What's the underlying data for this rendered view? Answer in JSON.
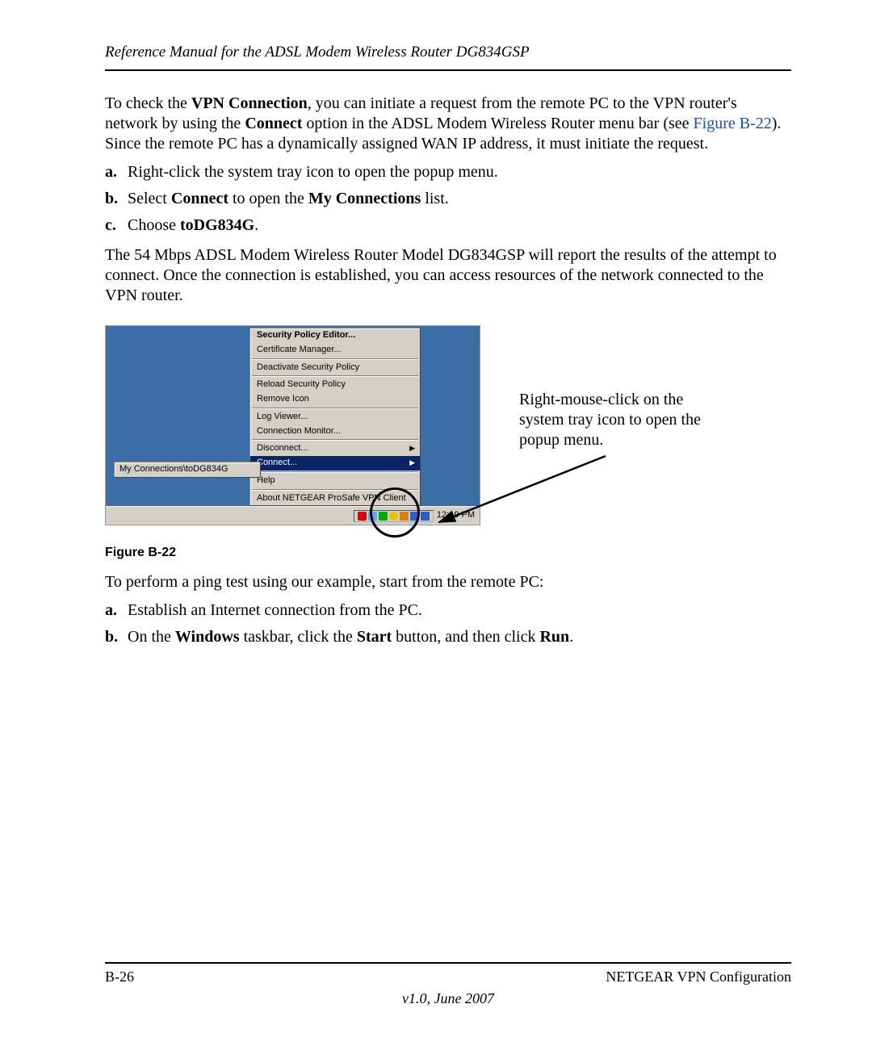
{
  "header": {
    "title": "Reference Manual for the ADSL Modem Wireless Router DG834GSP"
  },
  "intro": {
    "p1a": "To check the ",
    "vpn": "VPN Connection",
    "p1b": ", you can initiate a request from the remote PC to the VPN router's network by using the ",
    "connect": "Connect",
    "p1c": " option in the ADSL Modem Wireless Router menu bar (see ",
    "figlink": "Figure B-22",
    "p1d": "). Since the remote PC has a dynamically assigned WAN IP address, it must initiate the request."
  },
  "steps1": {
    "a": {
      "m": "a.",
      "t": "Right-click the system tray icon to open the popup menu."
    },
    "b": {
      "m": "b.",
      "pre": "Select ",
      "b1": "Connect",
      "mid": " to open the ",
      "b2": "My Connections",
      "post": " list."
    },
    "c": {
      "m": "c.",
      "pre": "Choose ",
      "b1": "toDG834G",
      "post": "."
    }
  },
  "result": "The 54 Mbps ADSL Modem Wireless Router Model DG834GSP will report the results of the attempt to connect. Once the connection is established, you can access resources of the network connected to the VPN router.",
  "menu": {
    "items": [
      "Security Policy Editor...",
      "Certificate Manager...",
      "Deactivate Security Policy",
      "Reload Security Policy",
      "Remove Icon",
      "Log Viewer...",
      "Connection Monitor...",
      "Disconnect...",
      "Connect...",
      "Help",
      "About NETGEAR ProSafe VPN Client"
    ],
    "submenu": "My Connections\\toDG834G",
    "clock": "12:19 PM"
  },
  "annotation": "Right-mouse-click on the system tray icon to open the popup menu.",
  "figcap": "Figure B-22",
  "pingintro": "To perform a ping test using our example, start from the remote PC:",
  "steps2": {
    "a": {
      "m": "a.",
      "t": "Establish an Internet connection from the PC."
    },
    "b": {
      "m": "b.",
      "pre": "On the ",
      "b1": "Windows",
      "mid": " taskbar, click the ",
      "b2": "Start",
      "mid2": " button, and then click ",
      "b3": "Run",
      "post": "."
    }
  },
  "footer": {
    "left": "B-26",
    "right": "NETGEAR VPN Configuration",
    "ver": "v1.0, June 2007"
  }
}
